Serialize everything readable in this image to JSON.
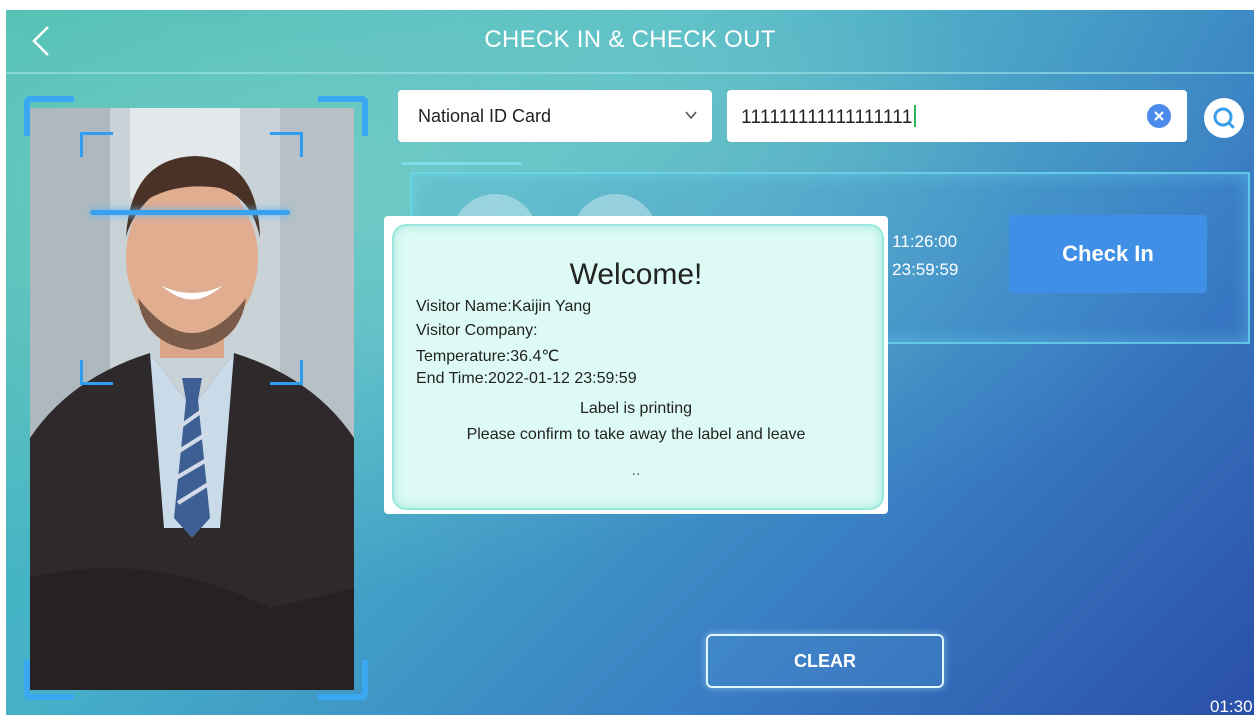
{
  "header": {
    "title": "CHECK IN & CHECK OUT",
    "back_icon": "chevron-left-icon"
  },
  "search": {
    "id_type": "National ID Card",
    "id_value": "111111111111111111",
    "clear_icon": "close-circle-icon",
    "search_icon": "search-icon"
  },
  "record": {
    "time_start_partial": "2 11:26:00",
    "time_end_partial": "2 23:59:59",
    "checkin_label": "Check In"
  },
  "modal": {
    "title": "Welcome!",
    "visitor_name": "Visitor Name:Kaijin Yang",
    "visitor_company": "Visitor Company:",
    "temperature": "Temperature:36.4℃",
    "end_time": "End Time:2022-01-12 23:59:59",
    "status": "Label is printing",
    "instruction": "Please confirm to take away the label and leave",
    "progress": ".."
  },
  "footer": {
    "clear_label": "CLEAR",
    "countdown": "01:30"
  },
  "colors": {
    "accent": "#3f8fe6",
    "scan": "#3aa0f0",
    "modal_bg": "#ddfbf4"
  }
}
